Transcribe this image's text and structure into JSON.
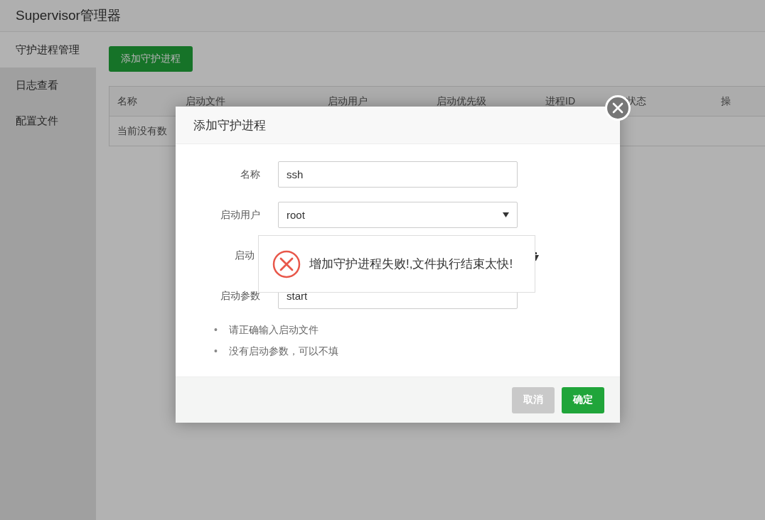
{
  "header": {
    "title": "Supervisor管理器"
  },
  "sidebar": {
    "items": [
      {
        "label": "守护进程管理",
        "selected": true
      },
      {
        "label": "日志查看",
        "selected": false
      },
      {
        "label": "配置文件",
        "selected": false
      }
    ]
  },
  "add_button": "添加守护进程",
  "table": {
    "columns": [
      "名称",
      "启动文件",
      "启动用户",
      "启动优先级",
      "进程ID",
      "状态",
      "操"
    ],
    "empty_text": "当前没有数"
  },
  "dialog": {
    "title": "添加守护进程",
    "fields": [
      {
        "kind": "text",
        "label": "名称",
        "value": "ssh"
      },
      {
        "kind": "select",
        "label": "启动用户",
        "value": "root"
      },
      {
        "kind": "file",
        "label": "启动"
      },
      {
        "kind": "text",
        "label": "启动参数",
        "value": "start"
      }
    ],
    "tips": [
      {
        "marker": "•",
        "text": "请正确输入启动文件"
      },
      {
        "marker": "•",
        "text": "没有启动参数，可以不填"
      }
    ],
    "buttons": [
      {
        "label": "取消",
        "kind": "cancel"
      },
      {
        "label": "确定",
        "kind": "primary"
      }
    ]
  },
  "toast": {
    "message": "增加守护进程失败!,文件执行结束太快!"
  }
}
